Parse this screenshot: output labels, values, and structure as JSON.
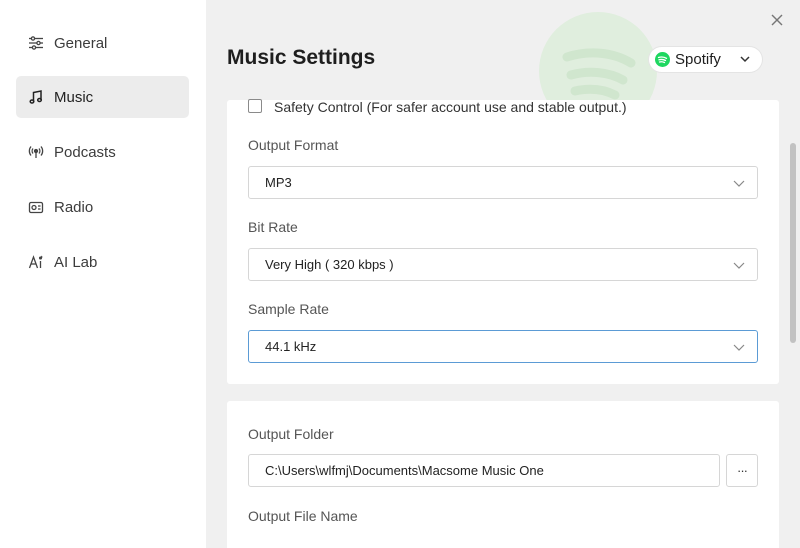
{
  "sidebar": {
    "items": [
      {
        "label": "General",
        "icon": "sliders-icon",
        "active": false
      },
      {
        "label": "Music",
        "icon": "music-note-icon",
        "active": true
      },
      {
        "label": "Podcasts",
        "icon": "podcast-icon",
        "active": false
      },
      {
        "label": "Radio",
        "icon": "radio-icon",
        "active": false
      },
      {
        "label": "AI Lab",
        "icon": "ai-icon",
        "active": false
      }
    ]
  },
  "main": {
    "title": "Music Settings",
    "source": {
      "selected": "Spotify",
      "icon": "spotify-logo-icon"
    },
    "safety_control": {
      "label": "Safety Control (For safer account use and stable output.)",
      "checked": false
    },
    "output_format": {
      "label": "Output Format",
      "value": "MP3"
    },
    "bit_rate": {
      "label": "Bit Rate",
      "value": "Very High ( 320 kbps )"
    },
    "sample_rate": {
      "label": "Sample Rate",
      "value": "44.1 kHz"
    },
    "output_folder": {
      "label": "Output Folder",
      "value": "C:\\Users\\wlfmj\\Documents\\Macsome Music One",
      "browse_label": "···"
    },
    "output_file_name": {
      "label": "Output File Name"
    }
  },
  "colors": {
    "accent_green": "#1ed760",
    "focus_border": "#5b9bd5",
    "active_nav_bg": "#ececec"
  }
}
